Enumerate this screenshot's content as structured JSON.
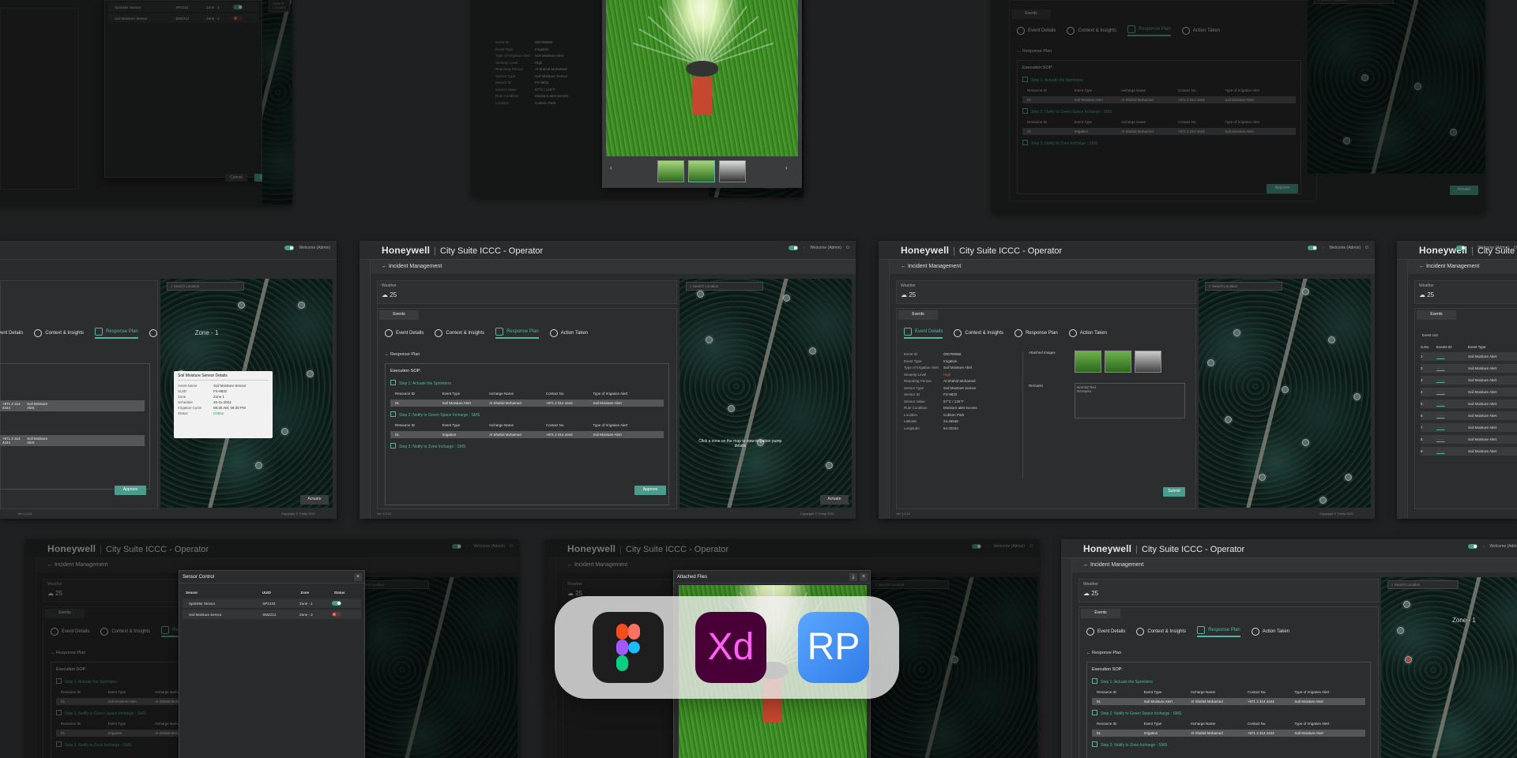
{
  "app": {
    "brand": "Honeywell",
    "suite": "City Suite ICCC - Operator",
    "user": "Welcome (Admin)"
  },
  "nav": {
    "page": "Incident Management",
    "back_label": "Response Plan"
  },
  "weather": {
    "label": "Weather",
    "temp": "25"
  },
  "events_tab": "Events",
  "tabs": [
    "Event Details",
    "Context & Insights",
    "Response Plan",
    "Action Taken"
  ],
  "sop": {
    "title": "Execution SOP:",
    "steps": [
      "Step 1: Actuate the Sprinklers",
      "Step 2: Notify to Green Space Incharge : SMS",
      "Step 3: Notify to Zone Incharge : SMS"
    ],
    "columns": [
      "Resource ID",
      "Event Type",
      "Incharge Name",
      "Contact No.",
      "Type of Irrigation Alert"
    ],
    "rows": [
      [
        "01",
        "Soil Moisture Alert",
        "Al Shahid Mohamed",
        "+971 2 314 4444",
        "Soil Moisture Alert"
      ],
      [
        "01",
        "Irrigation",
        "Al Shahid Mohamed",
        "+971 2 314 4444",
        "Soil Moisture Alert"
      ]
    ]
  },
  "buttons": {
    "approve": "Approve",
    "actuate": "Actuate",
    "submit": "Submit",
    "cancel": "Cancel",
    "deploy": "Deploy"
  },
  "map": {
    "search_placeholder": "Search Location",
    "zone_label": "Zone - 1",
    "hint": "Click a zone on the map to view irrigation pump details"
  },
  "footer": {
    "copyright": "Copyright © Trinity 2021",
    "version": "Ver 1.0.12"
  },
  "event_details": {
    "keys": [
      "Event ID",
      "Event Type",
      "Type of Irrigation Alert",
      "Severity Level",
      "Reporting Person",
      "Sensor Type",
      "Sensor ID",
      "Sensor Value",
      "Rule Condition",
      "Location",
      "Latitude",
      "Longitude"
    ],
    "values": [
      "000785966",
      "Irrigation",
      "Soil Moisture Alert",
      "High",
      "Al Shahid Mohamed",
      "Soil Moisture Sensor",
      "FS-9832",
      "57°C / 126°F",
      "Moisture alert excess",
      "Cubbon Park",
      "24.46548",
      "54.32244"
    ],
    "attached_images": "Attached Images",
    "remarks": "Remarks",
    "remarks_placeholder": "Remarks",
    "toolbar": "Normal Text"
  },
  "sensor_popup": {
    "title": "Soil Moisture Sensor Details",
    "keys": [
      "Asset Name",
      "UUID",
      "Zone",
      "Schedule",
      "Irrigation Cycle",
      "Status"
    ],
    "values": [
      "Soil Moisture Sensor",
      "FS-9832",
      "Zone 1",
      "26-11-2024",
      "09:30 AM, 06:30 PM",
      "Online"
    ]
  },
  "sensor_control": {
    "title": "Sensor Control",
    "columns": [
      "Sensor",
      "UUID",
      "Zone",
      "Status"
    ],
    "rows": [
      [
        "Sprinkler Sensor",
        "SP2133",
        "Zone - 1"
      ],
      [
        "Soil Moisture Sensor",
        "SMZ212",
        "Zone - 2"
      ]
    ]
  },
  "event_list": {
    "title": "Event List",
    "columns": [
      "S.No.",
      "Events ID",
      "Event Type"
    ],
    "type": "Soil Moisture Alert",
    "sno": [
      "1",
      "2",
      "3",
      "4",
      "5",
      "6",
      "7",
      "8",
      "9"
    ]
  },
  "attached_files": {
    "title": "Attached Files"
  },
  "tools": [
    {
      "name": "figma-icon",
      "label": ""
    },
    {
      "name": "adobe-xd-icon",
      "label": "Xd"
    },
    {
      "name": "axure-rp-icon",
      "label": "RP"
    }
  ],
  "colors": {
    "accent": "#58b3a4",
    "figma_bg": "#1e1e1e",
    "xd_bg": "#470137",
    "xd_fg": "#ff61f6",
    "rp_bg": "#2f7be8"
  }
}
